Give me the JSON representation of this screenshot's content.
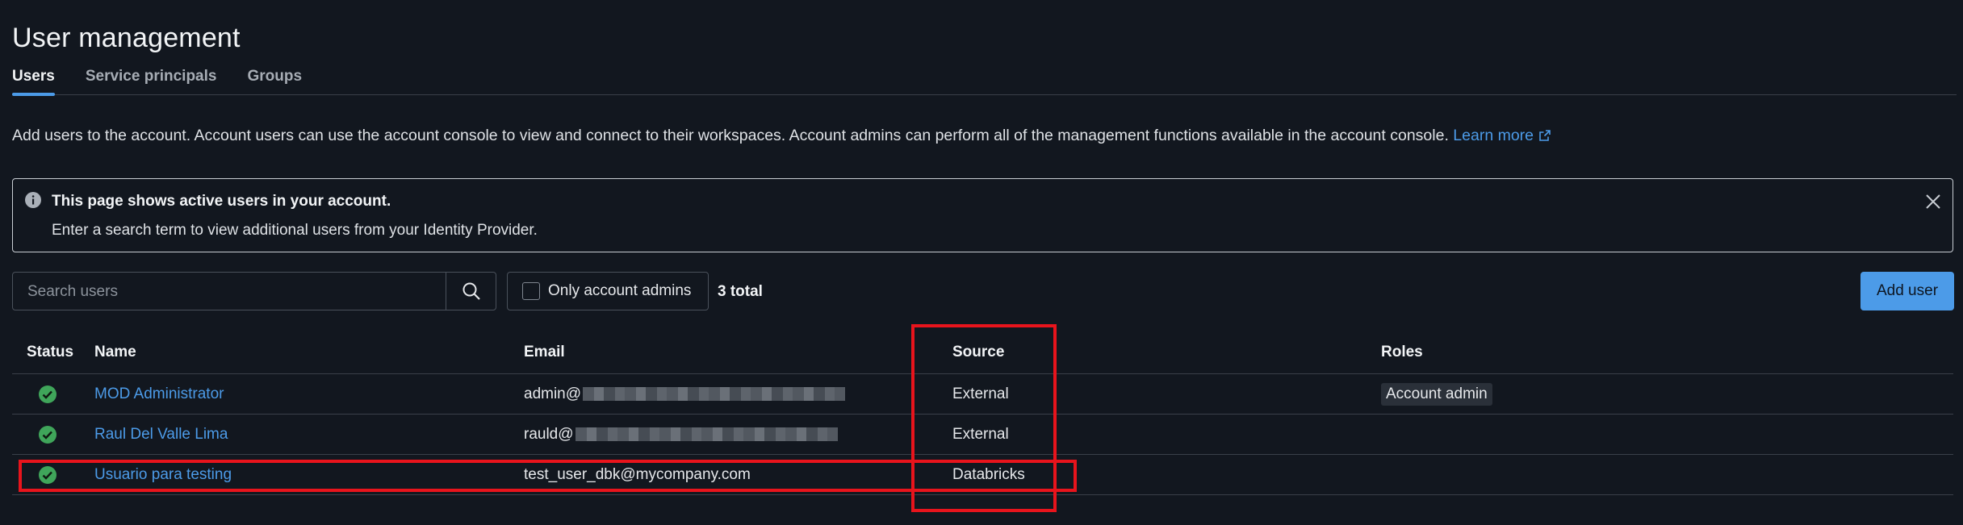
{
  "page": {
    "title": "User management",
    "tabs": [
      {
        "label": "Users",
        "active": true
      },
      {
        "label": "Service principals",
        "active": false
      },
      {
        "label": "Groups",
        "active": false
      }
    ],
    "description": "Add users to the account. Account users can use the account console to view and connect to their workspaces. Account admins can perform all of the management functions available in the account console.",
    "learn_more": "Learn more"
  },
  "banner": {
    "title": "This page shows active users in your account.",
    "text": "Enter a search term to view additional users from your Identity Provider."
  },
  "toolbar": {
    "search_placeholder": "Search users",
    "filter_label": "Only account admins",
    "total": "3 total",
    "add_user": "Add user"
  },
  "table": {
    "headers": {
      "status": "Status",
      "name": "Name",
      "email": "Email",
      "source": "Source",
      "roles": "Roles"
    },
    "rows": [
      {
        "name": "MOD Administrator",
        "email_visible": "admin@",
        "email_redacted": true,
        "source": "External",
        "role": "Account admin"
      },
      {
        "name": "Raul Del Valle Lima",
        "email_visible": "rauld@",
        "email_redacted": true,
        "source": "External",
        "role": ""
      },
      {
        "name": "Usuario para testing",
        "email_visible": "test_user_dbk@mycompany.com",
        "email_redacted": false,
        "source": "Databricks",
        "role": ""
      }
    ]
  },
  "colors": {
    "background": "#12171f",
    "accent": "#4c9be8",
    "status_active": "#3fa55a",
    "highlight": "#e8141c"
  },
  "icons": [
    "info-icon",
    "close-icon",
    "search-icon",
    "external-link-icon",
    "status-active-icon"
  ]
}
